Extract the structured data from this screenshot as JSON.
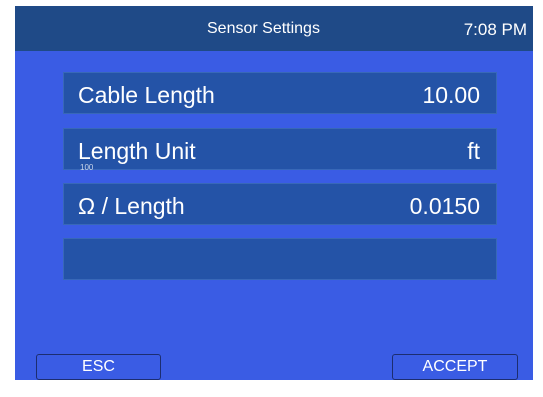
{
  "header": {
    "title": "Sensor Settings",
    "time": "7:08 PM"
  },
  "settings": [
    {
      "label": "Cable Length",
      "value": "10.00"
    },
    {
      "label": "Length Unit",
      "value": "ft",
      "underlay": "100"
    },
    {
      "label": "Ω / Length",
      "value": "0.0150"
    },
    {
      "label": "",
      "value": ""
    }
  ],
  "buttons": {
    "esc": "ESC",
    "accept": "ACCEPT"
  },
  "colors": {
    "screen_bg": "#3a5ce4",
    "header_bg": "#1f4a87",
    "row_bg": "#2453a7",
    "text": "#ffffff"
  }
}
